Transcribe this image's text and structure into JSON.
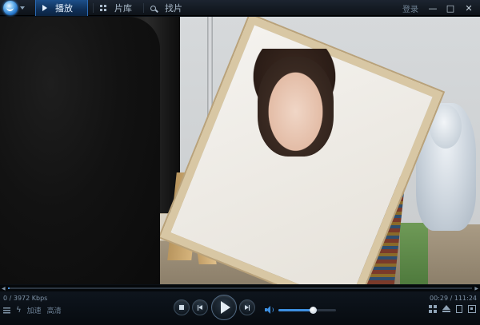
{
  "titlebar": {
    "tabs": [
      {
        "label": "播放",
        "active": true
      },
      {
        "label": "片库",
        "active": false
      },
      {
        "label": "找片",
        "active": false
      }
    ],
    "login_label": "登录",
    "minimize_glyph": "—",
    "restore_glyph": "□",
    "close_glyph": "✕"
  },
  "playback": {
    "bitrate_text": "0 / 3972 Kbps",
    "time_text": "00:29 / 111:24",
    "progress_fraction": 0.004,
    "volume_fraction": 0.6,
    "accelerate_label": "加速",
    "hd_label": "高清"
  },
  "colors": {
    "accent": "#3d8fe0",
    "active_tab": "#1d4f8a",
    "bar_background": "#0a0f15"
  },
  "icons": {
    "logo": "player-logo-icon",
    "stop": "stop-icon",
    "previous": "previous-icon",
    "play": "play-icon",
    "next": "next-icon",
    "volume": "volume-icon"
  }
}
